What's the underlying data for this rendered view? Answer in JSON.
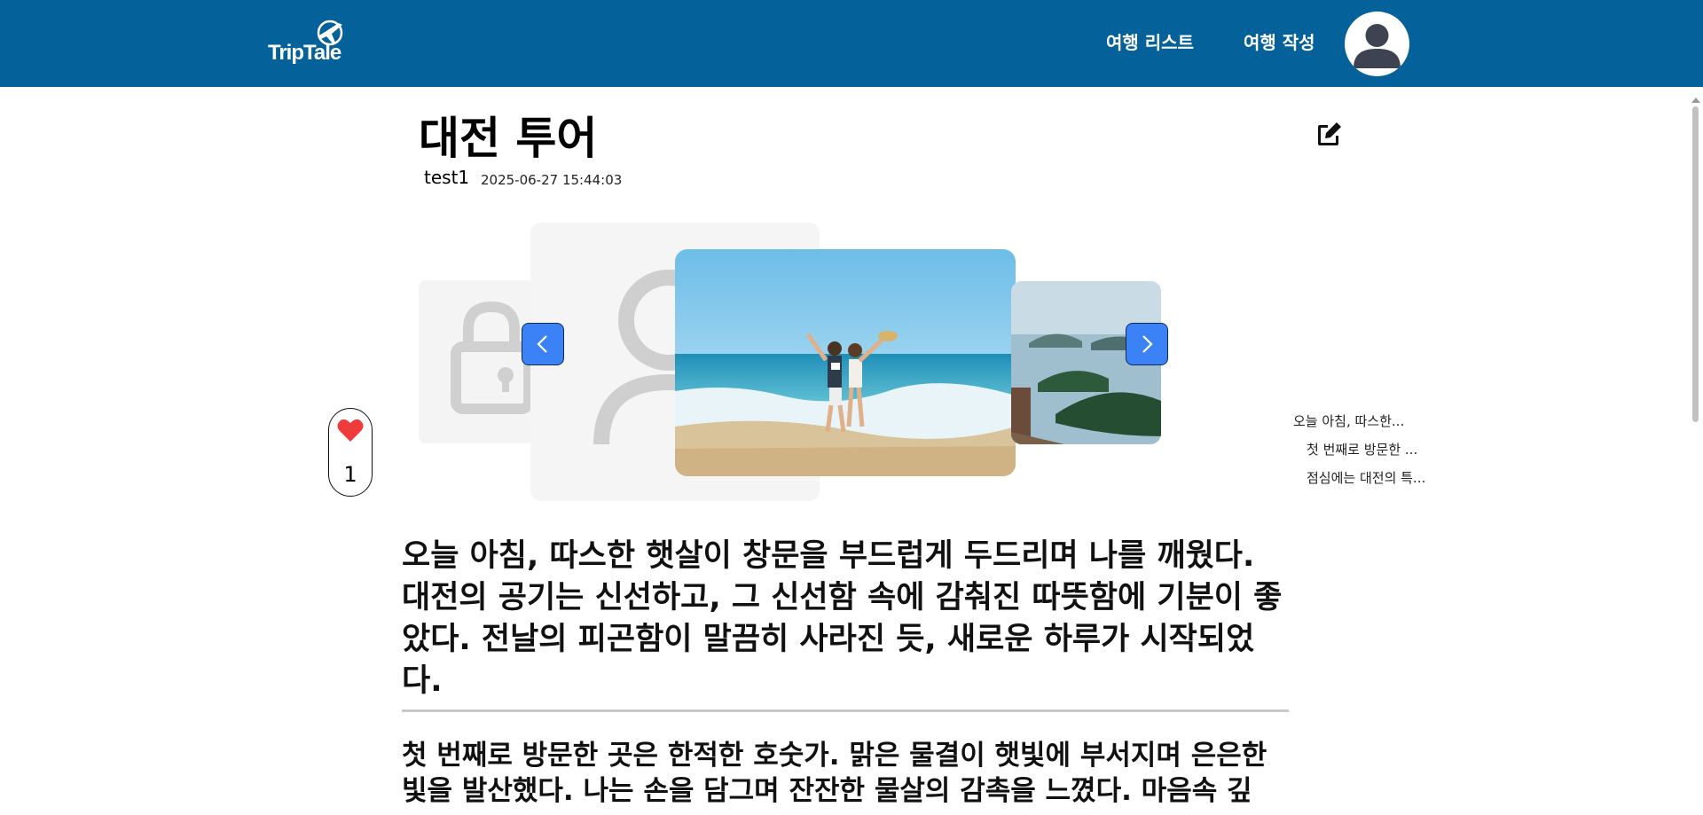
{
  "header": {
    "logo_text": "TripTale",
    "nav": [
      "여행 리스트",
      "여행 작성"
    ],
    "avatar_icon": "user-avatar-icon"
  },
  "post": {
    "title": "대전 투어",
    "author": "test1",
    "date": "2025-06-27 15:44:03",
    "edit_icon": "pencil-square-icon"
  },
  "carousel": {
    "prev_icon": "chevron-left-icon",
    "next_icon": "chevron-right-icon",
    "slides": [
      "lock placeholder",
      "user placeholder",
      "beach couple photo",
      "islands photo"
    ]
  },
  "like": {
    "icon": "heart-icon",
    "count": "1",
    "color": "#ef3b3b"
  },
  "toc": [
    "오늘 아침, 따스한...",
    "첫 번째로 방문한 ...",
    "점심에는 대전의 특..."
  ],
  "article": {
    "paragraphs": [
      "오늘 아침, 따스한 햇살이 창문을 부드럽게 두드리며 나를 깨웠다. 대전의 공기는 신선하고, 그 신선함 속에 감춰진 따뜻함에 기분이 좋았다. 전날의 피곤함이 말끔히 사라진 듯, 새로운 하루가 시작되었다.",
      "첫 번째로 방문한 곳은 한적한 호숫가. 맑은 물결이 햇빛에 부서지며 은은한 빛을 발산했다. 나는 손을 담그며 잔잔한 물살의 감촉을 느꼈다. 마음속 깊"
    ]
  },
  "colors": {
    "header_bg": "#05619a",
    "arrow_bg": "#3b82f6"
  }
}
